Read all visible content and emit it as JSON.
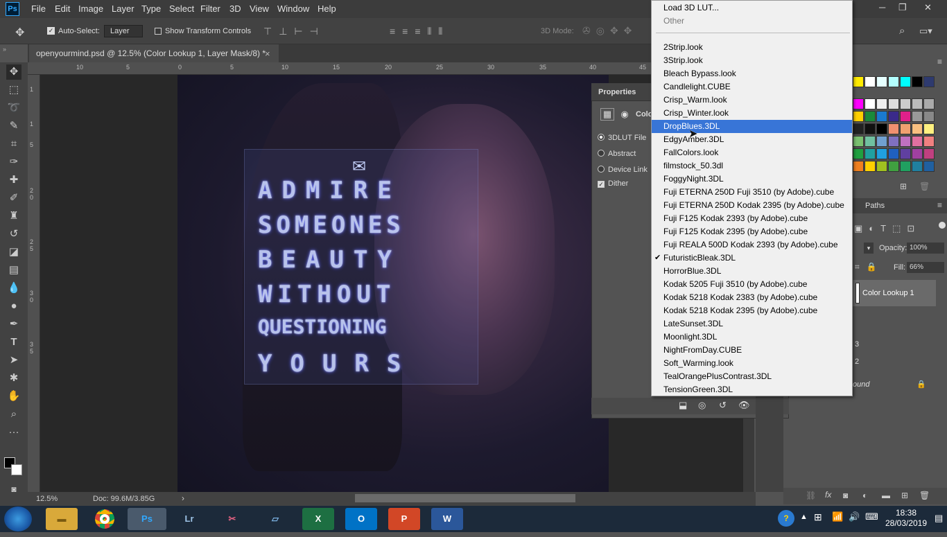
{
  "app": {
    "logo": "Ps"
  },
  "menubar": {
    "items": [
      "File",
      "Edit",
      "Image",
      "Layer",
      "Type",
      "Select",
      "Filter",
      "3D",
      "View",
      "Window",
      "Help"
    ]
  },
  "window_controls": {
    "minimize": "─",
    "restore": "❐",
    "close": "✕"
  },
  "options_bar": {
    "auto_select_label": "Auto-Select:",
    "auto_select_value": "Layer",
    "show_transform_label": "Show Transform Controls",
    "mode_3d_label": "3D Mode:"
  },
  "document_tab": {
    "title": "openyourmind.psd @ 12.5% (Color Lookup 1, Layer Mask/8) *",
    "close": "×"
  },
  "ruler_h": [
    "10",
    "5",
    "0",
    "5",
    "10",
    "15",
    "20",
    "25",
    "30",
    "35",
    "40",
    "45"
  ],
  "ruler_v": [
    "1",
    "1",
    "5",
    "2",
    "0",
    "2",
    "5",
    "3",
    "0",
    "3",
    "5"
  ],
  "canvas_text": [
    "ADMIRE",
    "SOMEONES",
    "BEAUTY",
    "WITHOUT",
    "QUESTIONING",
    "YOURS"
  ],
  "properties": {
    "title": "Properties",
    "adjustment_label": "Colo",
    "options": [
      {
        "label": "3DLUT File",
        "checked": true
      },
      {
        "label": "Abstract",
        "checked": false
      },
      {
        "label": "Device Link",
        "checked": false
      }
    ],
    "dither_label": "Dither"
  },
  "lut_dropdown": {
    "top_items": [
      "Load 3D LUT...",
      "Other"
    ],
    "items": [
      "2Strip.look",
      "3Strip.look",
      "Bleach Bypass.look",
      "Candlelight.CUBE",
      "Crisp_Warm.look",
      "Crisp_Winter.look",
      "DropBlues.3DL",
      "EdgyAmber.3DL",
      "FallColors.look",
      "filmstock_50.3dl",
      "FoggyNight.3DL",
      "Fuji ETERNA 250D Fuji 3510 (by Adobe).cube",
      "Fuji ETERNA 250D Kodak 2395 (by Adobe).cube",
      "Fuji F125 Kodak 2393 (by Adobe).cube",
      "Fuji F125 Kodak 2395 (by Adobe).cube",
      "Fuji REALA 500D Kodak 2393 (by Adobe).cube",
      "FuturisticBleak.3DL",
      "HorrorBlue.3DL",
      "Kodak 5205 Fuji 3510 (by Adobe).cube",
      "Kodak 5218 Kodak 2383 (by Adobe).cube",
      "Kodak 5218 Kodak 2395 (by Adobe).cube",
      "LateSunset.3DL",
      "Moonlight.3DL",
      "NightFromDay.CUBE",
      "Soft_Warming.look",
      "TealOrangePlusContrast.3DL",
      "TensionGreen.3DL"
    ],
    "highlighted": "DropBlues.3DL",
    "checked": "FuturisticBleak.3DL"
  },
  "layers": {
    "tab": "Paths",
    "opacity_label": "Opacity:",
    "opacity_value": "100%",
    "fill_label": "Fill:",
    "fill_value": "66%",
    "layer_name": "Color Lookup 1",
    "row3": "3",
    "row2": "2",
    "background": "ound"
  },
  "status": {
    "zoom": "12.5%",
    "doc": "Doc: 99.6M/3.85G"
  },
  "taskbar": {
    "time": "18:38",
    "date": "28/03/2019",
    "apps": [
      "Ps",
      "Lr",
      "X",
      "O",
      "P",
      "W"
    ]
  },
  "colors": {
    "selection": "#3875d7",
    "ps_blue": "#31a8ff"
  }
}
